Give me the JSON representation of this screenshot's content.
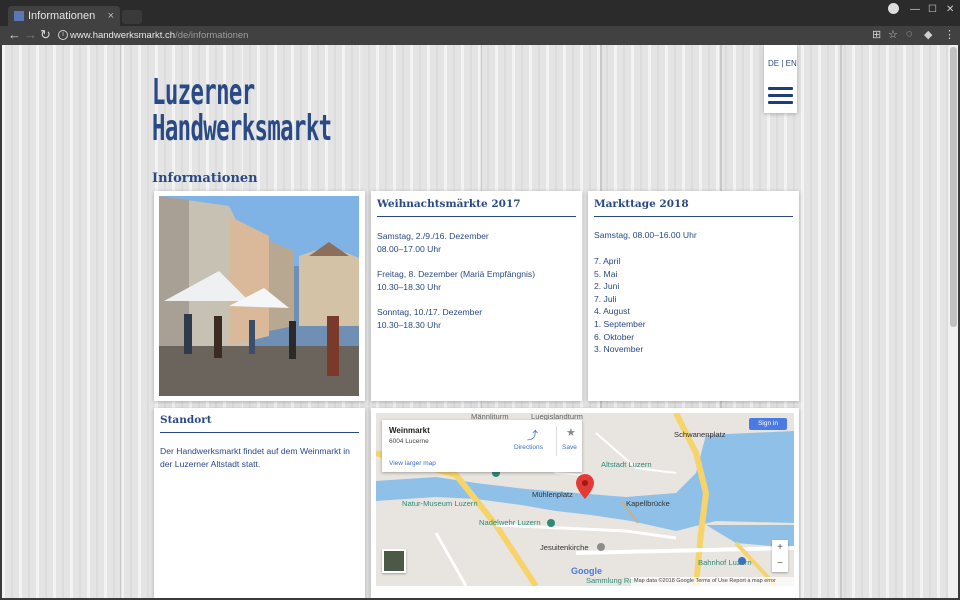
{
  "browser": {
    "tab_title": "Informationen",
    "tab_close": "×",
    "url_host": "www.handwerksmarkt.ch",
    "url_path": "/de/informationen"
  },
  "header": {
    "logo_line1": "Luzerner",
    "logo_line2": "Handwerksmarkt",
    "lang_de": "DE",
    "lang_sep": "|",
    "lang_en": "EN"
  },
  "page": {
    "title": "Informationen"
  },
  "christmas": {
    "heading": "Weihnachtsmärkte 2017",
    "entries": [
      {
        "date": "Samstag, 2./9./16. Dezember",
        "time": "08.00–17.00 Uhr"
      },
      {
        "date": "Freitag, 8. Dezember (Mariä Empfängnis)",
        "time": "10.30–18.30 Uhr"
      },
      {
        "date": "Sonntag, 10./17. Dezember",
        "time": "10.30–18.30 Uhr"
      }
    ]
  },
  "markets": {
    "heading": "Markttage 2018",
    "intro": "Samstag, 08.00–16.00 Uhr",
    "dates": [
      "7. April",
      "5. Mai",
      "2. Juni",
      "7. Juli",
      "4. August",
      "1. September",
      "6. Oktober",
      "3. November"
    ]
  },
  "location": {
    "heading": "Standort",
    "text": "Der Handwerksmarkt findet auf dem Weinmarkt in der Luzerner Altstadt statt."
  },
  "map": {
    "place_name": "Weinmarkt",
    "place_zip": "6004 Lucerne",
    "directions": "Directions",
    "save": "Save",
    "view_larger": "View larger map",
    "sign_in": "Sign in",
    "zoom_in": "+",
    "zoom_out": "−",
    "google": "Google",
    "attribution": "Map data ©2018 Google   Terms of Use   Report a map error",
    "labels": {
      "schwanenplatz": "Schwanenplatz",
      "altstadt": "Altstadt Luzern",
      "muehlenplatz": "Mühlenplatz",
      "kapellbruecke": "Kapellbrücke",
      "natur_museum": "Natur-Museum Luzern",
      "nadelwehr": "Nadelwehr Luzern",
      "jesuitenkirche": "Jesuitenkirche",
      "bahnhof": "Bahnhof Luzern",
      "sammlung": "Sammlung Ros",
      "maenliturm": "Männliturm",
      "luegisland": "Luegislandturm"
    },
    "colors": {
      "water": "#8fc1e8",
      "land": "#e8e4df",
      "road_major": "#f7d46b",
      "pin": "#e53935",
      "poi": "#2f8a78"
    }
  },
  "colors": {
    "brand": "#2a4a86"
  }
}
